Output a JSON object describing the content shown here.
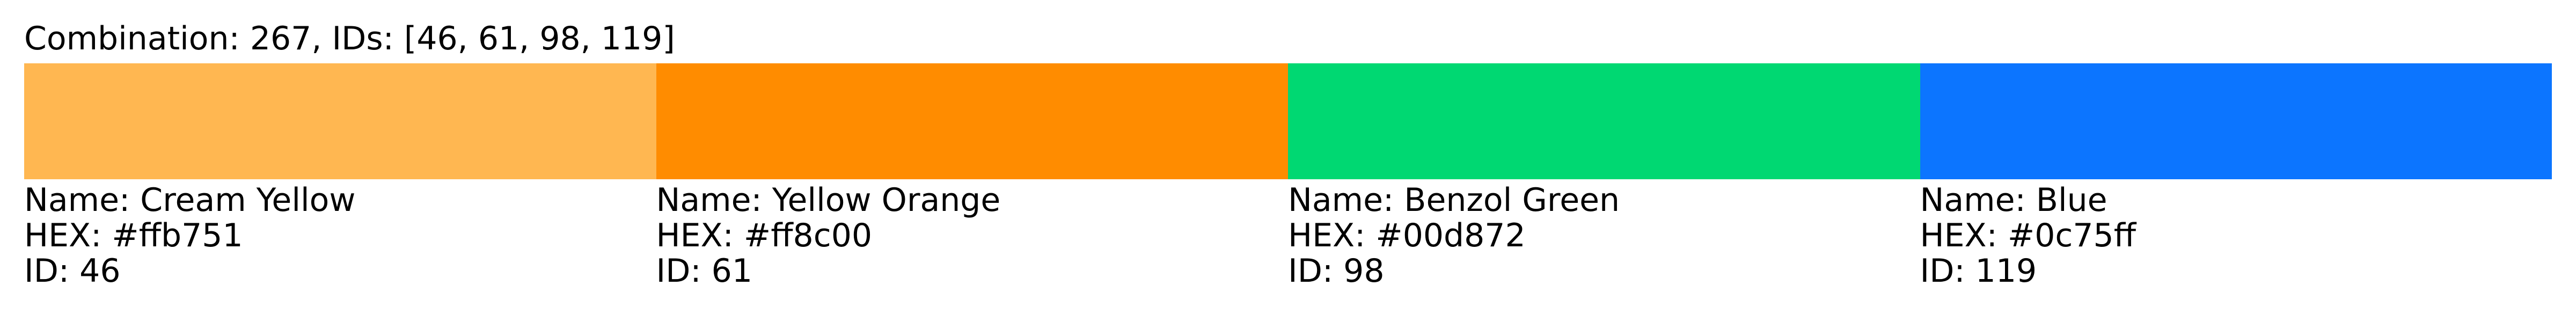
{
  "title": "Combination: 267, IDs: [46, 61, 98, 119]",
  "colors": [
    {
      "name_label": "Name: Cream Yellow",
      "hex_label": "HEX: #ffb751",
      "id_label": "ID: 46",
      "hex": "#ffb751"
    },
    {
      "name_label": "Name: Yellow Orange",
      "hex_label": "HEX: #ff8c00",
      "id_label": "ID: 61",
      "hex": "#ff8c00"
    },
    {
      "name_label": "Name: Benzol Green",
      "hex_label": "HEX: #00d872",
      "id_label": "ID: 98",
      "hex": "#00d872"
    },
    {
      "name_label": "Name: Blue",
      "hex_label": "HEX: #0c75ff",
      "id_label": "ID: 119",
      "hex": "#0c75ff"
    }
  ]
}
